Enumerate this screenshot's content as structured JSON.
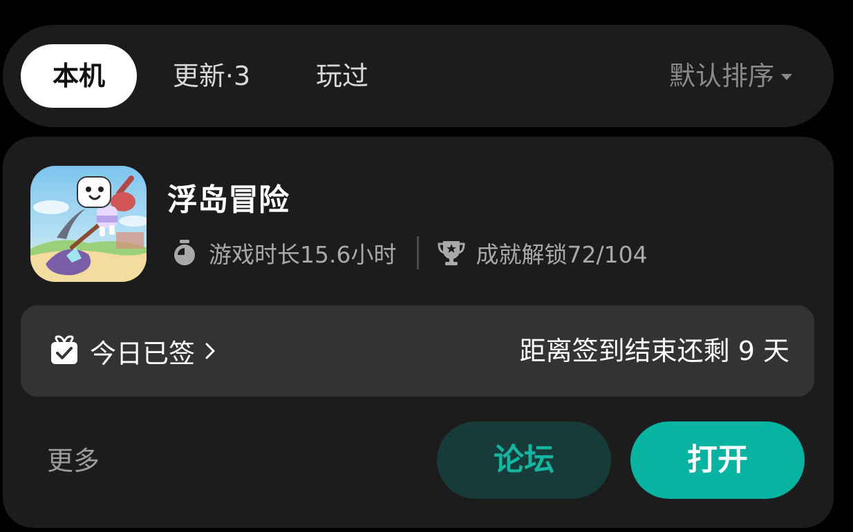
{
  "tabs": [
    {
      "label": "本机",
      "active": true
    },
    {
      "label": "更新·3",
      "active": false
    },
    {
      "label": "玩过",
      "active": false
    }
  ],
  "sort": {
    "label": "默认排序",
    "icon": "caret-down-icon"
  },
  "game": {
    "title": "浮岛冒险",
    "playtime": "游戏时长15.6小时",
    "achievements": "成就解锁72/104"
  },
  "signin": {
    "status": "今日已签",
    "countdown": "距离签到结束还剩 9 天"
  },
  "actions": {
    "more": "更多",
    "forum": "论坛",
    "open": "打开"
  },
  "colors": {
    "accent": "#07b3a1",
    "forum_bg": "#173b38",
    "card_bg": "#1c1c1c",
    "signin_bg": "#333333"
  }
}
